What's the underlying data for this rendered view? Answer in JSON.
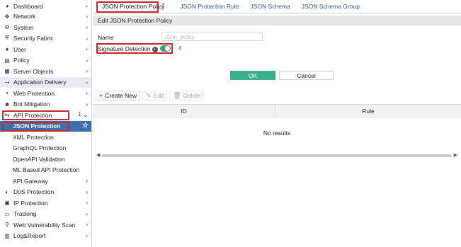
{
  "sidebar": {
    "items": [
      {
        "label": "Dashboard",
        "icon": "dashboard-icon",
        "glyph": "◕",
        "chevron": true
      },
      {
        "label": "Network",
        "icon": "network-icon",
        "glyph": "✥",
        "chevron": true
      },
      {
        "label": "System",
        "icon": "gear-icon",
        "glyph": "⚙",
        "chevron": true
      },
      {
        "label": "Security Fabric",
        "icon": "shield-icon",
        "glyph": "⛨",
        "chevron": true
      },
      {
        "label": "User",
        "icon": "user-icon",
        "glyph": "👤",
        "chevron": true
      },
      {
        "label": "Policy",
        "icon": "document-icon",
        "glyph": "▤",
        "chevron": true
      },
      {
        "label": "Server Objects",
        "icon": "server-icon",
        "glyph": "▦",
        "chevron": true
      },
      {
        "label": "Application Delivery",
        "icon": "delivery-icon",
        "glyph": "⇢",
        "chevron": true
      },
      {
        "label": "Web Protection",
        "icon": "lock-icon",
        "glyph": "🔒",
        "chevron": true
      },
      {
        "label": "Bot Mitigation",
        "icon": "bot-icon",
        "glyph": "☻",
        "chevron": true
      },
      {
        "label": "API Protection",
        "icon": "api-icon",
        "glyph": "⇆",
        "chevron": true
      },
      {
        "label": "JSON Protection",
        "child": true
      },
      {
        "label": "XML Protection",
        "child": true
      },
      {
        "label": "GraphQL Protection",
        "child": true
      },
      {
        "label": "OpenAPI Validation",
        "child": true
      },
      {
        "label": "ML Based API Protection",
        "child": true
      },
      {
        "label": "API Gateway",
        "child": true,
        "chevron": true
      },
      {
        "label": "DoS Protection",
        "icon": "dos-icon",
        "glyph": "◐",
        "chevron": true
      },
      {
        "label": "IP Protection",
        "icon": "ip-icon",
        "glyph": "▣",
        "chevron": true
      },
      {
        "label": "Tracking",
        "icon": "laptop-icon",
        "glyph": "▭",
        "chevron": true
      },
      {
        "label": "Web Vulnerability Scan",
        "icon": "scan-icon",
        "glyph": "⚲",
        "chevron": true
      },
      {
        "label": "Log&Report",
        "icon": "chart-icon",
        "glyph": "▥",
        "chevron": true
      }
    ]
  },
  "annotations": {
    "one": "1",
    "three": "3",
    "four": "4"
  },
  "tabs": [
    "JSON Protection Policy",
    "JSON Protection Rule",
    "JSON Schema",
    "JSON Schema Group"
  ],
  "form": {
    "section_title": "Edit JSON Protection Policy",
    "name_label": "Name",
    "name_value": "Json_policy",
    "signature_label": "Signature Detection",
    "signature_enabled": true,
    "ok_label": "OK",
    "cancel_label": "Cancel"
  },
  "toolbar": {
    "create_label": "Create New",
    "edit_label": "Edit",
    "delete_label": "Delete"
  },
  "table": {
    "columns": [
      "ID",
      "Rule"
    ],
    "empty_text": "No results"
  },
  "colors": {
    "accent": "#3b6fb0",
    "ok": "#3ab08b",
    "annotation": "#c9262c"
  }
}
